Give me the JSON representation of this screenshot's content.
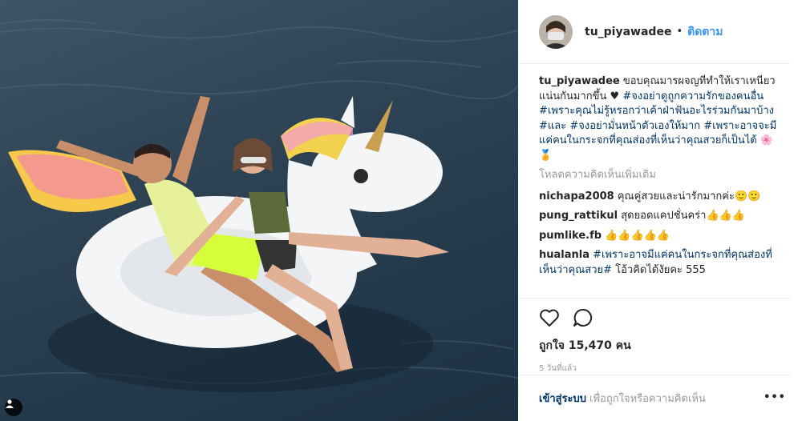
{
  "post": {
    "username": "tu_piyawadee",
    "separator": "•",
    "follow_label": "ติดตาม"
  },
  "caption": {
    "username": "tu_piyawadee",
    "text": "ขอบคุณมารผจญที่ทำให้เราเหนียวแน่นกันมากขึ้น ♥",
    "tags": "#จงอย่าดูถูกความรักของคนอื่น #เพราะคุณไม่รู้หรอกว่าเค้าฝ่าฟันอะไรร่วมกันมาบ้าง #และ #จงอย่ามั่นหน้าตัวเองให้มาก #เพราะอาจจะมีแค่คนในกระจกที่คุณส่องที่เห็นว่าคุณสวยก็เป็นได้",
    "emoji": "🌸🏅"
  },
  "load_more_label": "โหลดความคิดเห็นเพิ่มเติม",
  "comments": [
    {
      "user": "nichapa2008",
      "text": "คุณคู่สวยและน่ารักมากค่ะ🙂🙂"
    },
    {
      "user": "pung_rattikul",
      "text": "สุดยอดแคปชั่นคร่า👍👍👍"
    },
    {
      "user": "pumlike.fb",
      "text": "👍👍👍👍👍"
    },
    {
      "user": "hualanla",
      "tags": "#เพราะอาจมีแค่คนในกระจกที่คุณส่องที่เห็นว่าคุณสวย#",
      "text": "โอ้วคิดได้งัยคะ 555"
    }
  ],
  "likes_label": "ถูกใจ 15,470 คน",
  "time_label": "5 วันที่แล้ว",
  "footer": {
    "login_label": "เข้าสู่ระบบ",
    "rest_label": "เพื่อถูกใจหรือความคิดเห็น",
    "more_label": "•••"
  },
  "icons": {
    "like": "heart-icon",
    "comment": "comment-icon",
    "user_tag": "person-icon"
  }
}
